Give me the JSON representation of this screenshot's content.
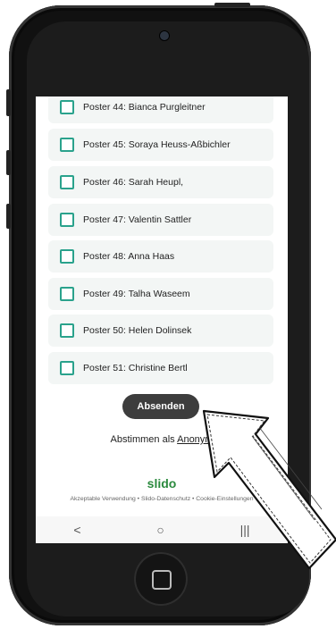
{
  "options": [
    "Poster 44: Bianca Purgleitner",
    "Poster 45: Soraya Heuss-Aßbichler",
    "Poster 46: Sarah Heupl,",
    "Poster 47: Valentin Sattler",
    "Poster 48: Anna Haas",
    "Poster 49: Talha Waseem",
    "Poster 50: Helen Dolinsek",
    "Poster 51: Christine Bertl"
  ],
  "submit_label": "Absenden",
  "anonymous": {
    "prefix": "Abstimmen als ",
    "link": "Anonym"
  },
  "brand": "slido",
  "footer": "Akzeptable Verwendung • Slido-Datenschutz • Cookie-Einstellungen",
  "nav": {
    "back": "<",
    "home": "○",
    "recent": "|||"
  },
  "colors": {
    "checkbox": "#2aa28c",
    "brand": "#2b8a3e",
    "button": "#3d3d3d"
  }
}
